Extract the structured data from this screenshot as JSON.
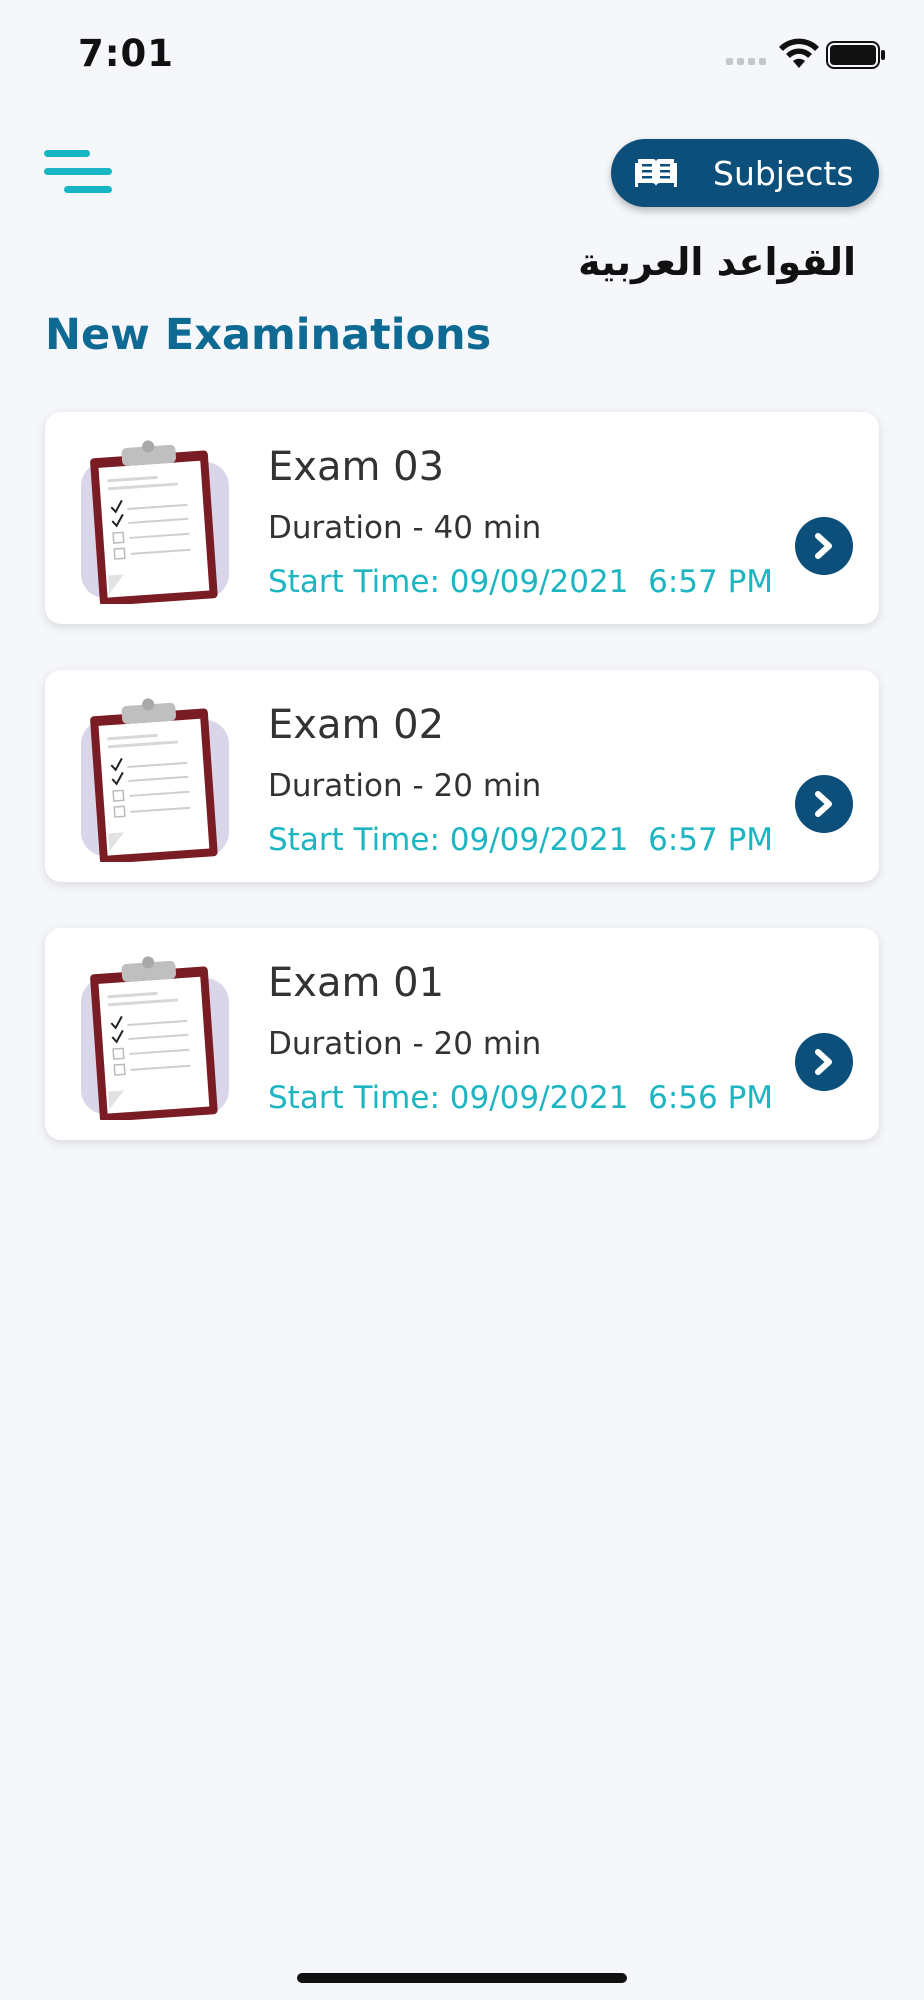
{
  "status_bar": {
    "time": "7:01"
  },
  "header": {
    "menu_icon": "hamburger-menu-icon",
    "subjects_button": {
      "label": "Subjects",
      "icon": "book-icon"
    }
  },
  "subject_title": "القواعد العربية",
  "section_title": "New Examinations",
  "exams": [
    {
      "name": "Exam 03",
      "duration": "Duration - 40 min",
      "start_time": "Start Time: 09/09/2021  6:57 PM"
    },
    {
      "name": "Exam 02",
      "duration": "Duration - 20 min",
      "start_time": "Start Time: 09/09/2021  6:57 PM"
    },
    {
      "name": "Exam 01",
      "duration": "Duration - 20 min",
      "start_time": "Start Time: 09/09/2021  6:56 PM"
    }
  ],
  "colors": {
    "accent": "#18b6c2",
    "primary": "#0c4f7a",
    "section_title": "#0f6a93",
    "background": "#f5f7fb"
  }
}
